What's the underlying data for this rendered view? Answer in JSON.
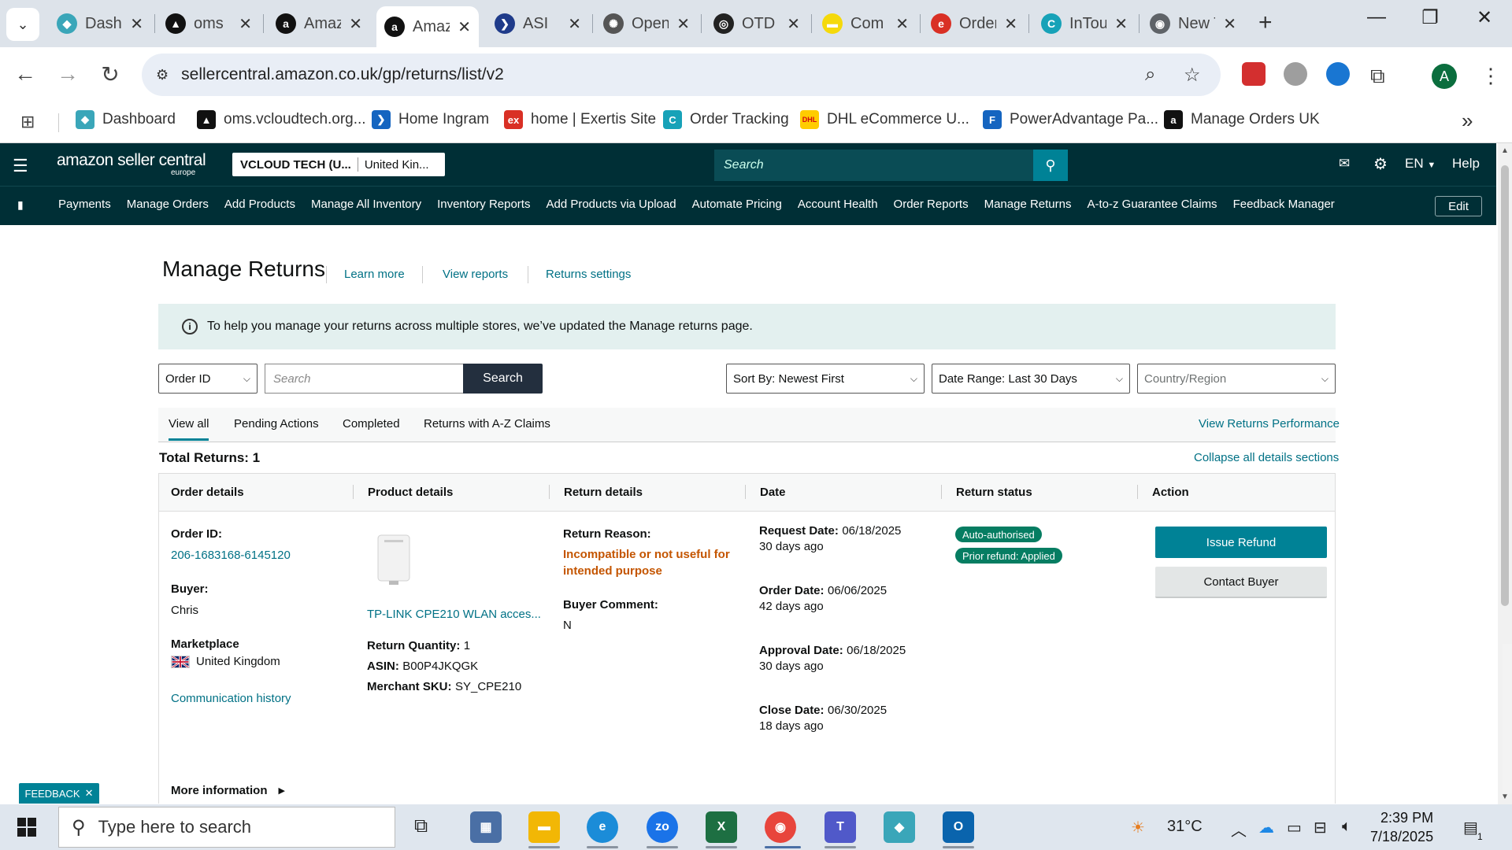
{
  "browser": {
    "tabs": [
      {
        "label": "Dashboard",
        "color": "#3aa6b9",
        "glyph": "◆",
        "active": false
      },
      {
        "label": "oms",
        "color": "#111111",
        "glyph": "▲",
        "active": false
      },
      {
        "label": "Amazon",
        "color": "#111111",
        "glyph": "a",
        "active": false
      },
      {
        "label": "Amazon",
        "color": "#111111",
        "glyph": "a",
        "active": true
      },
      {
        "label": "ASI",
        "color": "#1f3b8a",
        "glyph": "❯",
        "active": false
      },
      {
        "label": "OpenAI",
        "color": "#555555",
        "glyph": "✺",
        "active": false
      },
      {
        "label": "OTD",
        "color": "#222222",
        "glyph": "◎",
        "active": false
      },
      {
        "label": "Com",
        "color": "#f5d90a",
        "glyph": "▬",
        "active": false
      },
      {
        "label": "Orders",
        "color": "#d93025",
        "glyph": "e",
        "active": false
      },
      {
        "label": "InTouch",
        "color": "#17a2b8",
        "glyph": "C",
        "active": false
      },
      {
        "label": "New Tab",
        "color": "#5f6368",
        "glyph": "◉",
        "active": false
      }
    ],
    "url": "sellercentral.amazon.co.uk/gp/returns/list/v2",
    "bookmarks": [
      {
        "label": "Dashboard",
        "color": "#3aa6b9",
        "glyph": "◆"
      },
      {
        "label": "oms.vcloudtech.org...",
        "color": "#111111",
        "glyph": "▲"
      },
      {
        "label": "Home Ingram",
        "color": "#1565c0",
        "glyph": "❯"
      },
      {
        "label": "home | Exertis Site",
        "color": "#d93025",
        "glyph": "ex"
      },
      {
        "label": "Order Tracking",
        "color": "#17a2b8",
        "glyph": "C"
      },
      {
        "label": "DHL eCommerce U...",
        "color": "#ffcc00",
        "glyph": "DHL"
      },
      {
        "label": "PowerAdvantage Pa...",
        "color": "#1565c0",
        "glyph": "F"
      },
      {
        "label": "Manage Orders UK",
        "color": "#111111",
        "glyph": "a"
      }
    ],
    "bookmarks_more": "»"
  },
  "header": {
    "logo_main": "amazon",
    "logo_sub": "seller central",
    "logo_region": "europe",
    "store_name": "VCLOUD TECH (U...",
    "store_market": "United Kin...",
    "search_placeholder": "Search",
    "language": "EN",
    "help": "Help"
  },
  "nav": {
    "items": [
      "Payments",
      "Manage Orders",
      "Add Products",
      "Manage All Inventory",
      "Inventory Reports",
      "Add Products via Upload",
      "Automate Pricing",
      "Account Health",
      "Order Reports",
      "Manage Returns",
      "A-to-z Guarantee Claims",
      "Feedback Manager"
    ],
    "edit": "Edit"
  },
  "page": {
    "title": "Manage Returns",
    "links": [
      "Learn more",
      "View reports",
      "Returns settings"
    ],
    "banner": "To help you manage your returns across multiple stores, we’ve updated the Manage returns page.",
    "filters": {
      "id_type": "Order ID",
      "search_placeholder": "Search",
      "search_button": "Search",
      "sort": "Sort By: Newest First",
      "date_range": "Date Range: Last 30 Days",
      "country_placeholder": "Country/Region"
    },
    "tabs": [
      "View all",
      "Pending Actions",
      "Completed",
      "Returns with A-Z Claims"
    ],
    "view_performance": "View Returns Performance",
    "total_label": "Total Returns: 1",
    "collapse_all": "Collapse all details sections",
    "columns": [
      "Order details",
      "Product details",
      "Return details",
      "Date",
      "Return status",
      "Action"
    ],
    "row": {
      "order_id_label": "Order ID:",
      "order_id": "206-1683168-6145120",
      "buyer_label": "Buyer:",
      "buyer": "Chris",
      "marketplace_label": "Marketplace",
      "marketplace": "United Kingdom",
      "communication": "Communication history",
      "product_name": "TP-LINK CPE210 WLAN acces...",
      "qty_label": "Return Quantity:",
      "qty": "1",
      "asin_label": "ASIN:",
      "asin": "B00P4JKQGK",
      "sku_label": "Merchant SKU:",
      "sku": "SY_CPE210",
      "reason_label": "Return Reason:",
      "reason": "Incompatible or not useful for intended purpose",
      "comment_label": "Buyer Comment:",
      "comment": "N",
      "request_label": "Request Date:",
      "request_date": "06/18/2025",
      "request_ago": "30 days ago",
      "order_label": "Order Date:",
      "order_date": "06/06/2025",
      "order_ago": "42 days ago",
      "approval_label": "Approval Date:",
      "approval_date": "06/18/2025",
      "approval_ago": "30 days ago",
      "close_label": "Close Date:",
      "close_date": "06/30/2025",
      "close_ago": "18 days ago",
      "status_badges": [
        "Auto-authorised",
        "Prior refund: Applied"
      ],
      "issue_refund": "Issue Refund",
      "contact_buyer": "Contact Buyer",
      "more_info": "More information"
    },
    "feedback": "FEEDBACK"
  },
  "taskbar": {
    "search_placeholder": "Type here to search",
    "weather": "31°C",
    "time": "2:39 PM",
    "date": "7/18/2025",
    "notification_count": "1"
  },
  "colors": {
    "header_bg": "#002f36",
    "accent": "#008296",
    "link": "#007185",
    "status_green": "#067d62",
    "reason_orange": "#c45500"
  }
}
